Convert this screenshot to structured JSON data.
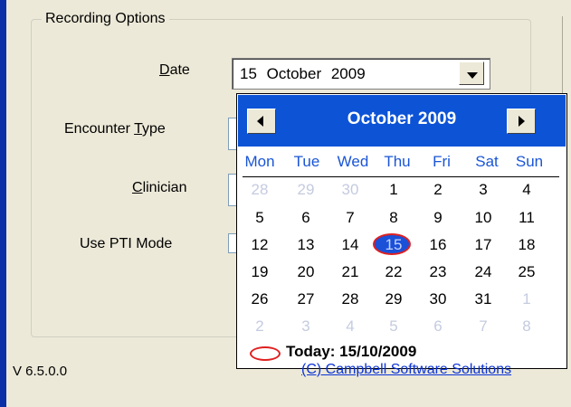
{
  "group": {
    "title": "Recording Options"
  },
  "fields": {
    "date_label": {
      "pre": "",
      "accel": "D",
      "post": "ate"
    },
    "encounter_label": {
      "pre": "Encounter ",
      "accel": "T",
      "post": "ype"
    },
    "clinician_label": {
      "pre": "",
      "accel": "C",
      "post": "linician"
    },
    "pti_label": "Use PTI Mode"
  },
  "date_combo": {
    "value": "15 October 2009"
  },
  "calendar": {
    "title": "October 2009",
    "weekdays": [
      "Mon",
      "Tue",
      "Wed",
      "Thu",
      "Fri",
      "Sat",
      "Sun"
    ],
    "weeks": [
      [
        "28",
        "29",
        "30",
        "1",
        "2",
        "3",
        "4"
      ],
      [
        "5",
        "6",
        "7",
        "8",
        "9",
        "10",
        "11"
      ],
      [
        "12",
        "13",
        "14",
        "15",
        "16",
        "17",
        "18"
      ],
      [
        "19",
        "20",
        "21",
        "22",
        "23",
        "24",
        "25"
      ],
      [
        "26",
        "27",
        "28",
        "29",
        "30",
        "31",
        "1"
      ],
      [
        "2",
        "3",
        "4",
        "5",
        "6",
        "7",
        "8"
      ]
    ],
    "selected_day": "15",
    "today_label": "Today: 15/10/2009"
  },
  "footer": {
    "version": "V 6.5.0.0",
    "company": "(C) Campbell Software Solutions"
  },
  "colors": {
    "header_blue": "#0c53d6",
    "weekday_blue": "#1a55d6",
    "today_red": "#e02020",
    "other_month_gray": "#c5cbe0"
  }
}
